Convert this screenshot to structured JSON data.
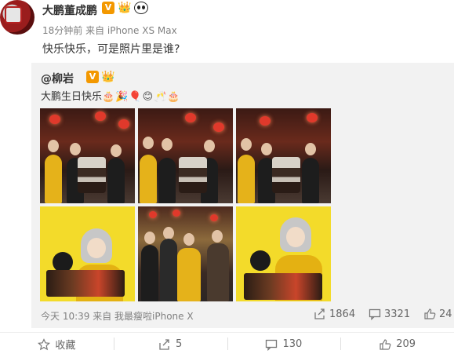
{
  "post": {
    "author": "大鹏董成鹏",
    "badge_v": "V",
    "meta": "18分钟前 来自 iPhone XS Max",
    "text": "快乐快乐，可是照片里是谁?"
  },
  "repost": {
    "author": "@柳岩",
    "badge_v": "V",
    "text": "大鹏生日快乐",
    "emoji_tail": "🎂🎉🎈😊🥂🎂",
    "footer": "今天 10:39 来自 我最瘦啦iPhone X",
    "stats": {
      "share": "1864",
      "comment": "3321",
      "like": "24"
    }
  },
  "actions": {
    "favorite": "收藏",
    "share": "5",
    "comment": "130",
    "like": "209"
  },
  "colors": {
    "badge": "#f39800",
    "meta_gray": "#808080",
    "repost_bg": "#f2f2f2"
  }
}
